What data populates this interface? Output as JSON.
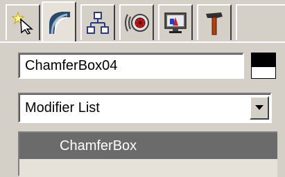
{
  "command_panel": {
    "tabs": [
      {
        "name": "create",
        "icon": "create-icon"
      },
      {
        "name": "modify",
        "icon": "modify-icon"
      },
      {
        "name": "hierarchy",
        "icon": "hierarchy-icon"
      },
      {
        "name": "motion",
        "icon": "motion-icon"
      },
      {
        "name": "display",
        "icon": "display-icon"
      },
      {
        "name": "utilities",
        "icon": "hammer-icon"
      }
    ],
    "active_tab": "modify",
    "object_name": "ChamferBox04",
    "object_color": "#000000",
    "modifier_list_label": "Modifier List",
    "modifier_stack": [
      "ChamferBox"
    ],
    "colors": {
      "panel_bg": "#d4d0c8",
      "stack_selected": "#6b6b6b"
    }
  }
}
